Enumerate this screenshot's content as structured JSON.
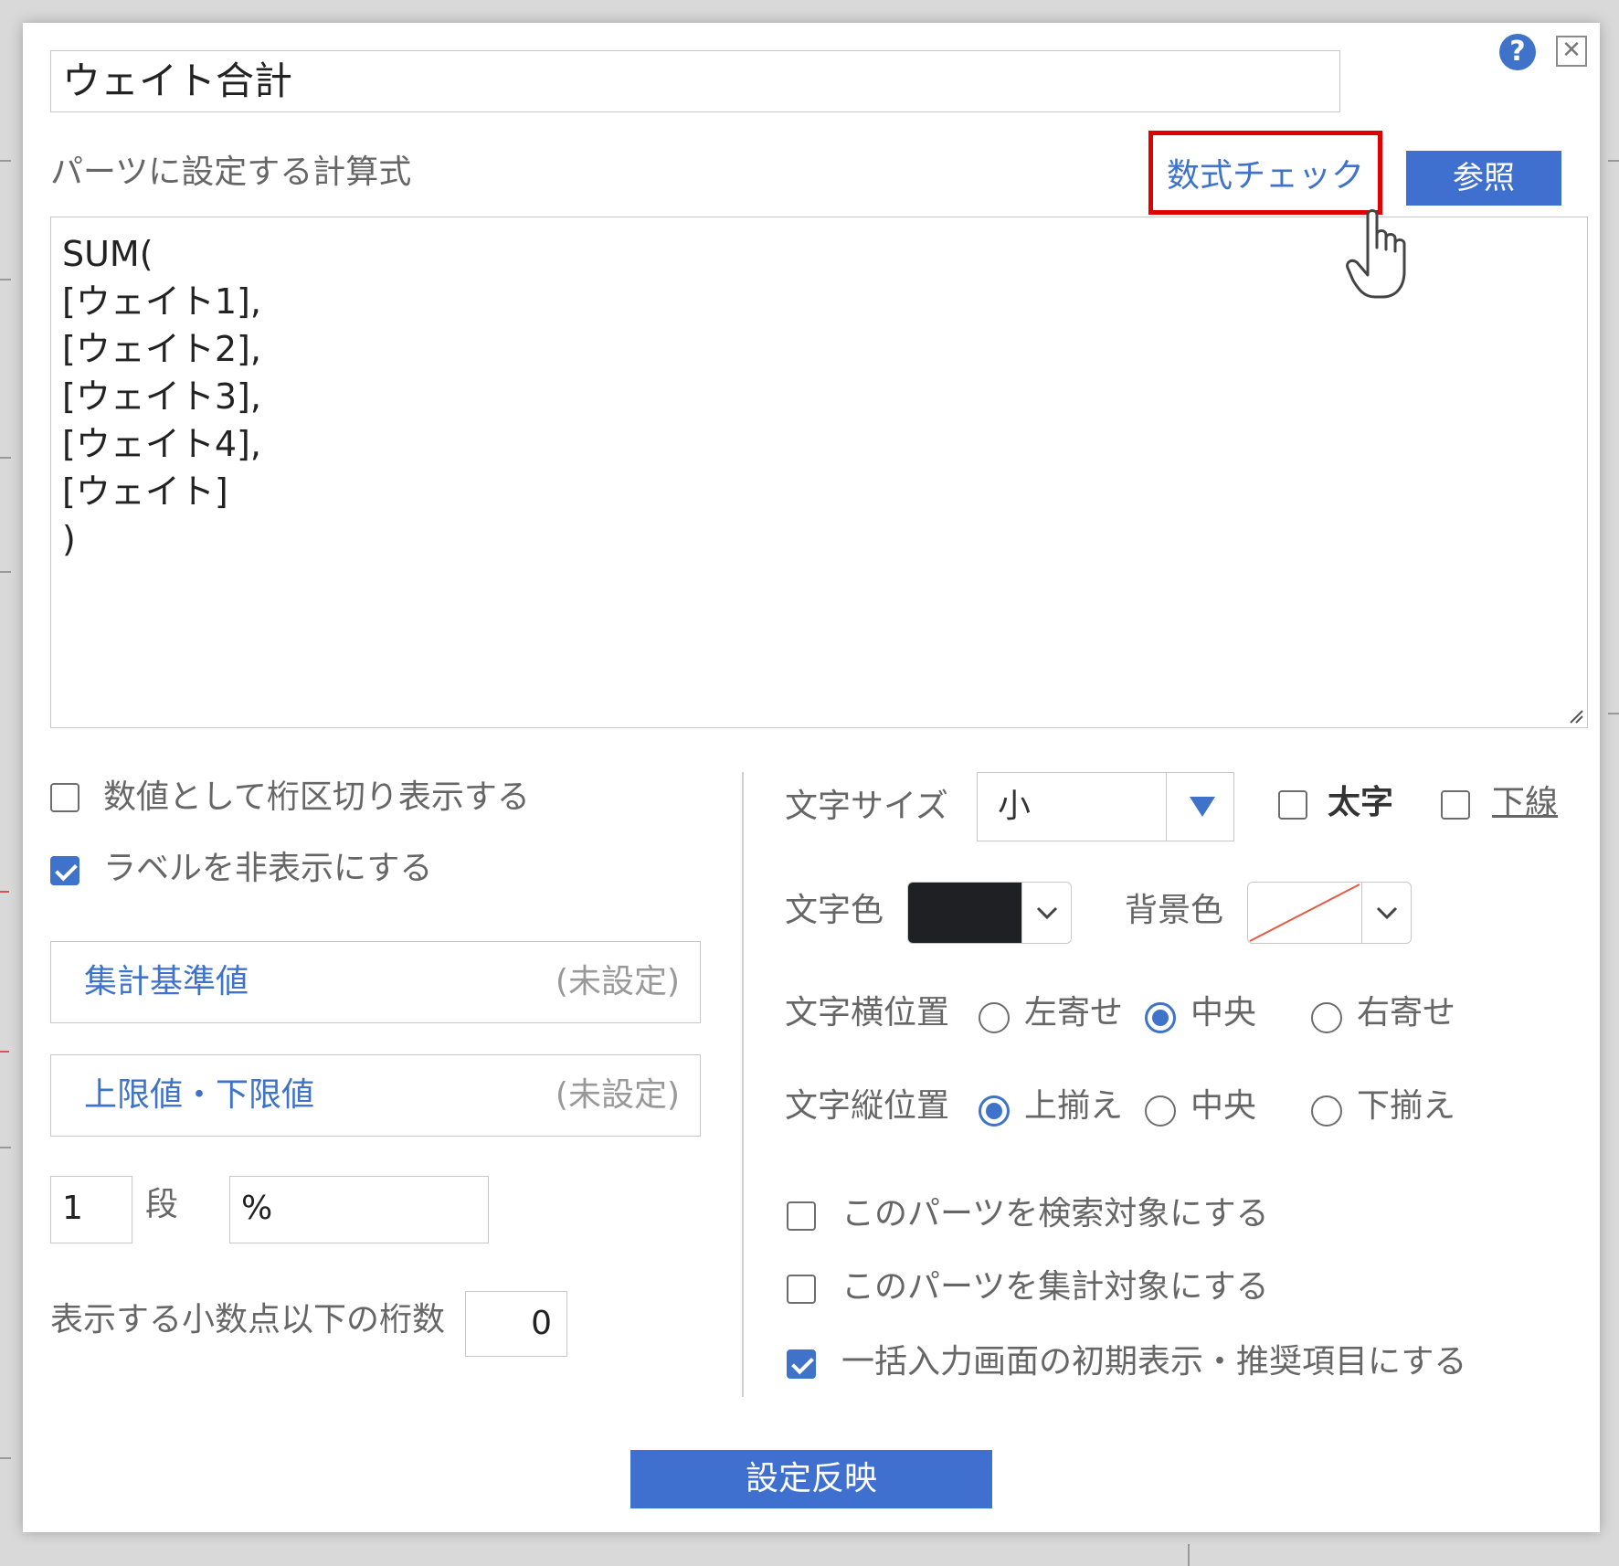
{
  "dialog": {
    "part_name": "ウェイト合計",
    "help_icon_glyph": "?",
    "close_icon_glyph": "✕"
  },
  "formula": {
    "label": "パーツに設定する計算式",
    "check_link": "数式チェック",
    "reference_button": "参照",
    "lines": [
      "SUM(",
      "[ウェイト1],",
      "[ウェイト2],",
      "[ウェイト3],",
      "[ウェイト4],",
      "[ウェイト]",
      ")"
    ]
  },
  "left_options": {
    "separator_checkbox": {
      "label": "数値として桁区切り表示する",
      "checked": false
    },
    "hide_label_checkbox": {
      "label": "ラベルを非表示にする",
      "checked": true
    },
    "aggregate_base": {
      "title": "集計基準値",
      "status": "(未設定)"
    },
    "limits": {
      "title": "上限値・下限値",
      "status": "(未設定)"
    },
    "rows_value": "1",
    "rows_unit": "段",
    "suffix_value": "%",
    "decimal_label": "表示する小数点以下の桁数",
    "decimal_value": "0"
  },
  "right_options": {
    "font_size_label": "文字サイズ",
    "font_size_value": "小",
    "bold_label": "太字",
    "underline_label": "下線",
    "text_color_label": "文字色",
    "text_color": "#1f2023",
    "bg_color_label": "背景色",
    "h_align_label": "文字横位置",
    "h_align_options": [
      "左寄せ",
      "中央",
      "右寄せ"
    ],
    "h_align_selected": "中央",
    "v_align_label": "文字縦位置",
    "v_align_options": [
      "上揃え",
      "中央",
      "下揃え"
    ],
    "v_align_selected": "上揃え",
    "search_target": {
      "label": "このパーツを検索対象にする",
      "checked": false
    },
    "aggregate_target": {
      "label": "このパーツを集計対象にする",
      "checked": false
    },
    "bulk_input": {
      "label": "一括入力画面の初期表示・推奨項目にする",
      "checked": true
    }
  },
  "apply_button": "設定反映",
  "colors": {
    "accent": "#3f73c9",
    "highlight_box": "#e00000"
  }
}
